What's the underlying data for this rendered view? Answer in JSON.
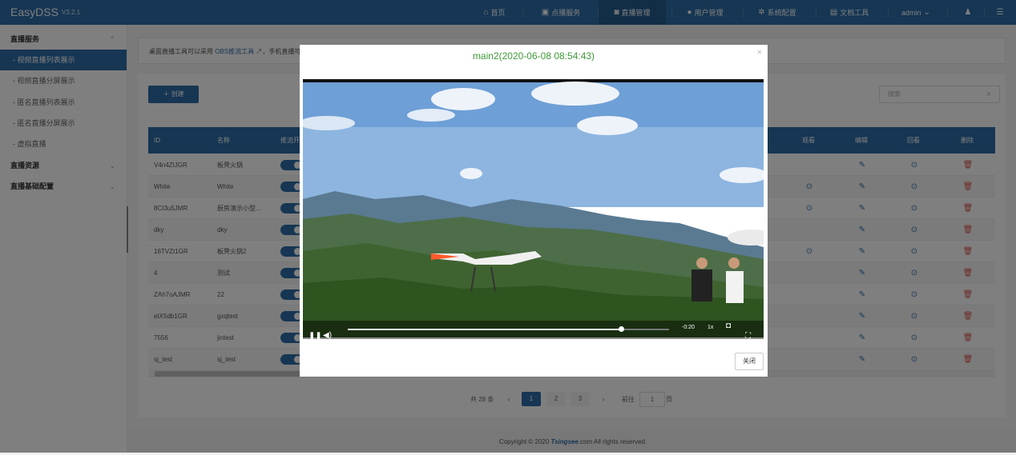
{
  "app": {
    "name": "EasyDSS",
    "version": "V3.2.1"
  },
  "nav": {
    "items": [
      {
        "label": "首页",
        "icon": "dashboard-icon"
      },
      {
        "label": "点播服务",
        "icon": "video-icon"
      },
      {
        "label": "直播管理",
        "icon": "camera-icon"
      },
      {
        "label": "用户管理",
        "icon": "user-icon"
      },
      {
        "label": "系统配置",
        "icon": "gear-icon"
      },
      {
        "label": "文档工具",
        "icon": "book-icon"
      }
    ],
    "user": "admin",
    "bell": "bell-icon",
    "menu": "menu-icon"
  },
  "sidebar": {
    "groups": [
      {
        "label": "直播服务"
      },
      {
        "label": "直播资源"
      },
      {
        "label": "直播基础配置"
      }
    ],
    "items": [
      {
        "label": "- 视频直播列表展示"
      },
      {
        "label": "- 视频直播分屏展示"
      },
      {
        "label": "- 匿名直播列表展示"
      },
      {
        "label": "- 匿名直播分屏展示"
      },
      {
        "label": "- 虚拟直播"
      }
    ]
  },
  "notice": {
    "text": "桌面直播工具可以采用 ",
    "link": "OBS推流工具",
    "rest": "，手机直播可以..."
  },
  "toolbar": {
    "create_label": "创建",
    "search_placeholder": "搜索"
  },
  "table": {
    "headers": {
      "id": "ID",
      "name": "名称",
      "push": "推流开",
      "watch": "观看",
      "edit": "编辑",
      "playback": "回看",
      "delete": "删除"
    },
    "rows": [
      {
        "id": "V4n4ZIJGR",
        "name": "板凳火锅"
      },
      {
        "id": "White",
        "name": "White"
      },
      {
        "id": "8CI3u5JMR",
        "name": "厨房演示小型..."
      },
      {
        "id": "dky",
        "name": "dky"
      },
      {
        "id": "16TVZt1GR",
        "name": "板凳火锅2"
      },
      {
        "id": "4",
        "name": "测试"
      },
      {
        "id": "ZAh7oAJMR",
        "name": "22"
      },
      {
        "id": "etX5db1GR",
        "name": "gxqtest"
      },
      {
        "id": "7556",
        "name": "jintest"
      },
      {
        "id": "sj_test",
        "name": "sj_test"
      }
    ]
  },
  "pagination": {
    "total": "共 28 条",
    "pages": [
      "1",
      "2",
      "3"
    ],
    "goto_label": "前往",
    "goto_value": "1",
    "page_suffix": "页",
    "prev": "‹",
    "next": "›"
  },
  "footer": {
    "prefix": "Copyright © 2020 ",
    "brand": "Tsingsee",
    "suffix": ".com All rights reserved"
  },
  "modal": {
    "title": "main2(2020-06-08 08:54:43)",
    "close_label": "关闭",
    "close_x": "×",
    "player": {
      "time": "-0:20",
      "rate": "1x",
      "progress": 0.85
    }
  },
  "colors": {
    "primary": "#2d6da7",
    "title_green": "#3f9a39",
    "delete_red": "#d9534f"
  }
}
